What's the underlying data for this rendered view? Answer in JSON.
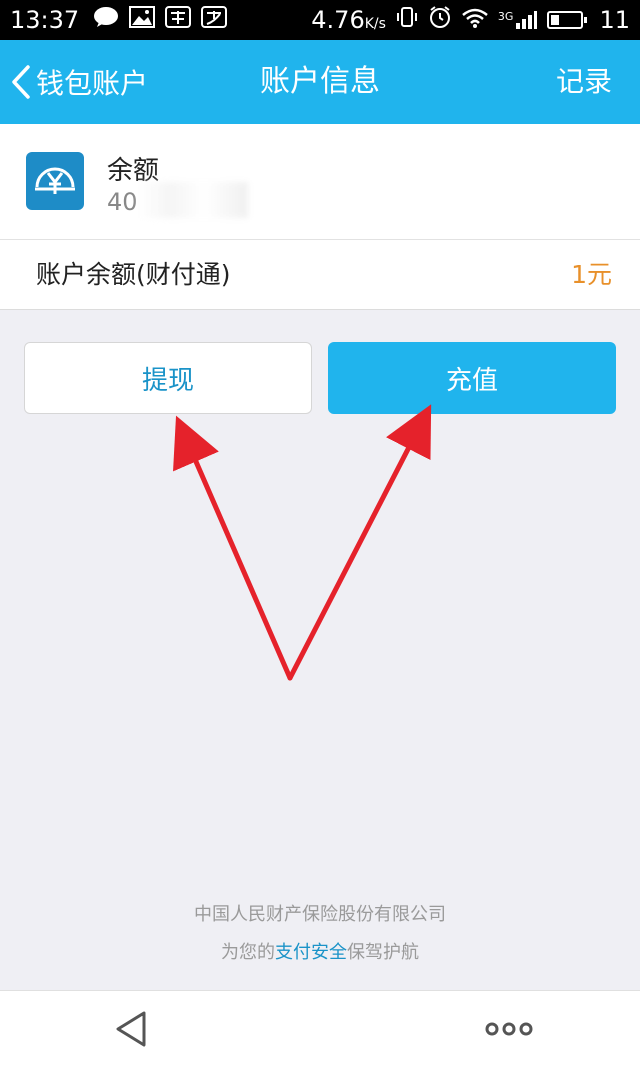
{
  "status_bar": {
    "time": "13:37",
    "net_speed": "4.76",
    "net_unit": "K/s",
    "signal": "3G",
    "battery": "11"
  },
  "nav": {
    "back_label": "钱包账户",
    "title": "账户信息",
    "right_label": "记录"
  },
  "account": {
    "label": "余额",
    "number_prefix": "40"
  },
  "balance": {
    "label": "账户余额(财付通)",
    "value": "1元"
  },
  "actions": {
    "withdraw": "提现",
    "recharge": "充值"
  },
  "footer": {
    "line1": "中国人民财产保险股份有限公司",
    "line2_pre": "为您的",
    "line2_highlight": "支付安全",
    "line2_post": "保驾护航"
  },
  "colors": {
    "accent": "#20b4ed",
    "balance_value": "#e8902a",
    "arrow": "#e5222b"
  }
}
